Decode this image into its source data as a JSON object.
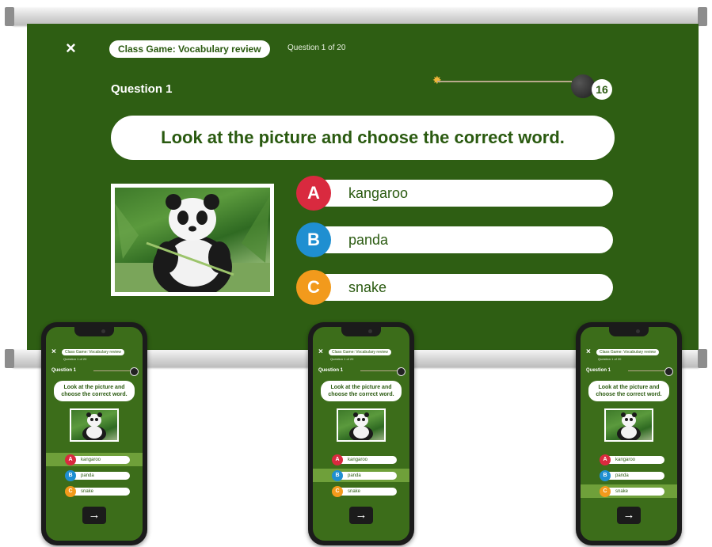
{
  "screen": {
    "close_icon": "×",
    "game_title": "Class Game: Vocabulary review",
    "question_counter": "Question 1 of 20",
    "question_label": "Question 1",
    "timer_value": "16",
    "prompt": "Look at the picture and choose the correct word.",
    "image_subject": "panda",
    "answers": [
      {
        "letter": "A",
        "text": "kangaroo",
        "color": "#d92a3f"
      },
      {
        "letter": "B",
        "text": "panda",
        "color": "#1f8fd1"
      },
      {
        "letter": "C",
        "text": "snake",
        "color": "#f29a1c"
      }
    ]
  },
  "phones": [
    {
      "game_title": "Class Game: Vocabulary review",
      "question_counter": "Question 1 of 20",
      "question_label": "Question 1",
      "prompt": "Look at the picture and choose the correct word.",
      "answers": [
        "kangaroo",
        "panda",
        "snake"
      ],
      "selected": 0,
      "next_icon": "→"
    },
    {
      "game_title": "Class Game: Vocabulary review",
      "question_counter": "Question 1 of 20",
      "question_label": "Question 1",
      "prompt": "Look at the picture and choose the correct word.",
      "answers": [
        "kangaroo",
        "panda",
        "snake"
      ],
      "selected": 1,
      "next_icon": "→"
    },
    {
      "game_title": "Class Game: Vocabulary review",
      "question_counter": "Question 1 of 20",
      "question_label": "Question 1",
      "prompt": "Look at the picture and choose the correct word.",
      "answers": [
        "kangaroo",
        "panda",
        "snake"
      ],
      "selected": 2,
      "next_icon": "→"
    }
  ],
  "colors": {
    "screen_green": "#2e5e13",
    "phone_green": "#3c6d1a",
    "highlight_green": "#6fa03a",
    "text_green": "#2a5a10"
  }
}
